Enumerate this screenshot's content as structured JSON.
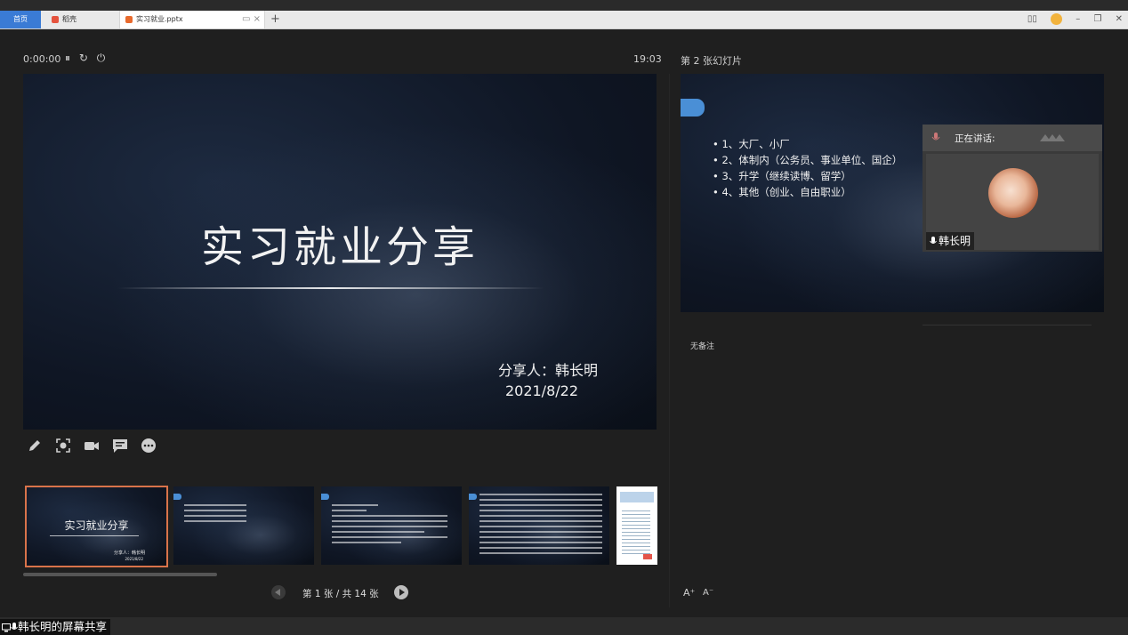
{
  "tabs": {
    "home": "首页",
    "docer": "稻壳",
    "file": "实习就业.pptx"
  },
  "window": {
    "add_tab": "+"
  },
  "presenter": {
    "timer": "0:00:00",
    "clock": "19:03",
    "next_slide_title": "第 2 张幻灯片",
    "notes": "无备注"
  },
  "current_slide": {
    "title": "实习就业分享",
    "presenter": "分享人：韩长明",
    "date": "2021/8/22"
  },
  "next_slide": {
    "items": [
      "1、大厂、小厂",
      "2、体制内（公务员、事业单位、国企）",
      "3、升学（继续读博、留学）",
      "4、其他（创业、自由职业）"
    ]
  },
  "speaker": {
    "label": "正在讲话:",
    "name": "韩长明"
  },
  "thumbnails": {
    "t1_title": "实习就业分享",
    "t1_name": "分享人：韩长明",
    "t1_date": "2021/8/22"
  },
  "navigation": {
    "page_indicator": "第 1 张 / 共 14 张",
    "current": 1,
    "total": 14
  },
  "font_controls": {
    "increase": "A⁺",
    "decrease": "A⁻"
  },
  "share": {
    "label": "韩长明的屏幕共享"
  },
  "colors": {
    "accent_tab": "#3a7bd5",
    "active_thumb_border": "#d9734a",
    "slide_tag": "#4a8fd6"
  },
  "icons": [
    "pen-icon",
    "spotlight-icon",
    "camera-icon",
    "chat-icon",
    "more-icon",
    "pause-icon",
    "restart-icon",
    "power-icon",
    "mic-icon"
  ]
}
